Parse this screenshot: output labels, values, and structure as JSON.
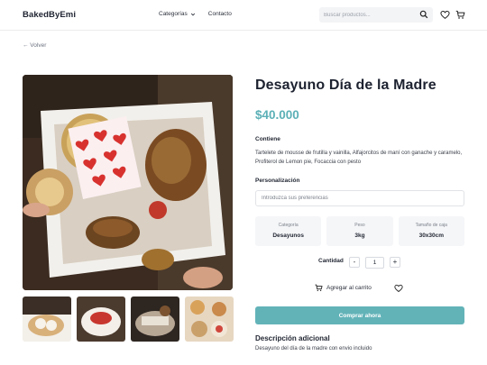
{
  "header": {
    "brand": "BakedByEmi",
    "nav": [
      {
        "label": "Categorías"
      },
      {
        "label": "Contacto"
      }
    ],
    "search_placeholder": "Buscar productos...",
    "icons": [
      "search-icon",
      "heart-icon",
      "cart-icon"
    ]
  },
  "back_label": "← Volver",
  "product": {
    "title": "Desayuno Día de la Madre",
    "price": "$40.000",
    "contents_label": "Contiene",
    "contents": "Tartelete de mousse de frutilla y vainilla, Alfajorcitos de maní con ganache y caramelo, Profiterol de Lemon pie, Focaccia con pesto",
    "personalization_label": "Personalización",
    "personalization_placeholder": "Introduzca sus preferencias",
    "specs": [
      {
        "label": "Categoría",
        "value": "Desayunos"
      },
      {
        "label": "Peso",
        "value": "3kg"
      },
      {
        "label": "Tamaño de caja",
        "value": "30x30cm"
      }
    ],
    "quantity_label": "Cantidad",
    "quantity": "1",
    "minus": "-",
    "plus": "+",
    "add_to_cart": "Agregar al carrito",
    "buy_now": "Comprar ahora",
    "description_title": "Descripción adicional",
    "description": "Desayuno del día de la madre con envio incluido"
  },
  "colors": {
    "accent": "#5bb0b6",
    "button": "#62b3b8",
    "text": "#1f2430"
  }
}
